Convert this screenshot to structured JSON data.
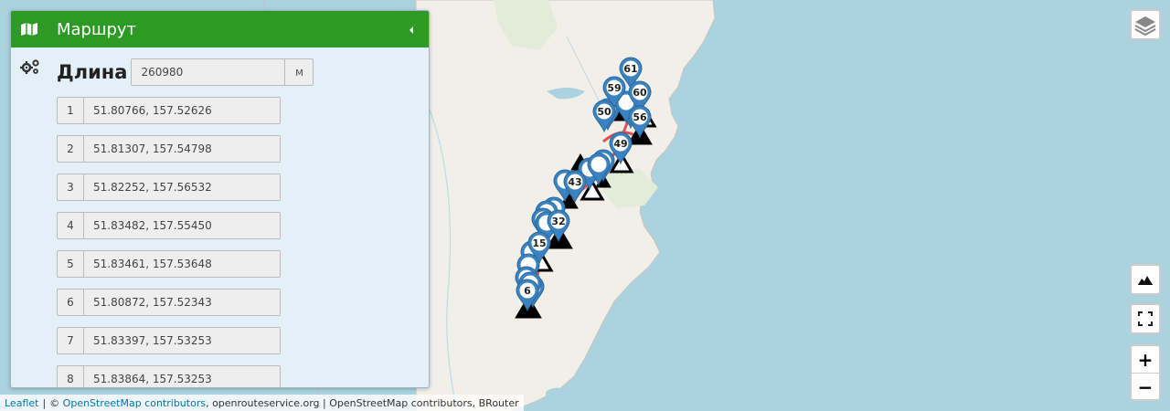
{
  "panel": {
    "title": "Маршрут",
    "length_label": "Длина",
    "length_value": "260980",
    "length_unit": "м",
    "waypoints": [
      {
        "index": "1",
        "coords": "51.80766, 157.52626"
      },
      {
        "index": "2",
        "coords": "51.81307, 157.54798"
      },
      {
        "index": "3",
        "coords": "51.82252, 157.56532"
      },
      {
        "index": "4",
        "coords": "51.83482, 157.55450"
      },
      {
        "index": "5",
        "coords": "51.83461, 157.53648"
      },
      {
        "index": "6",
        "coords": "51.80872, 157.52343"
      },
      {
        "index": "7",
        "coords": "51.83397, 157.53253"
      },
      {
        "index": "8",
        "coords": "51.83864, 157.53253"
      }
    ]
  },
  "map": {
    "markers": [
      "61",
      "59",
      "60",
      "50",
      "56",
      "49",
      "43",
      "32",
      "15",
      "6"
    ],
    "colors": {
      "water": "#aad3df",
      "land": "#f2efe9",
      "marker": "#3a82c0",
      "route": "#e05050",
      "header": "#2c9a24"
    }
  },
  "controls": {
    "zoom_in": "+",
    "zoom_out": "−"
  },
  "attribution": {
    "leaflet": "Leaflet",
    "separator": "|",
    "copyright": "©",
    "osm": "OpenStreetMap contributors",
    "rest": ", openrouteservice.org | OpenStreetMap contributors, BRouter"
  }
}
